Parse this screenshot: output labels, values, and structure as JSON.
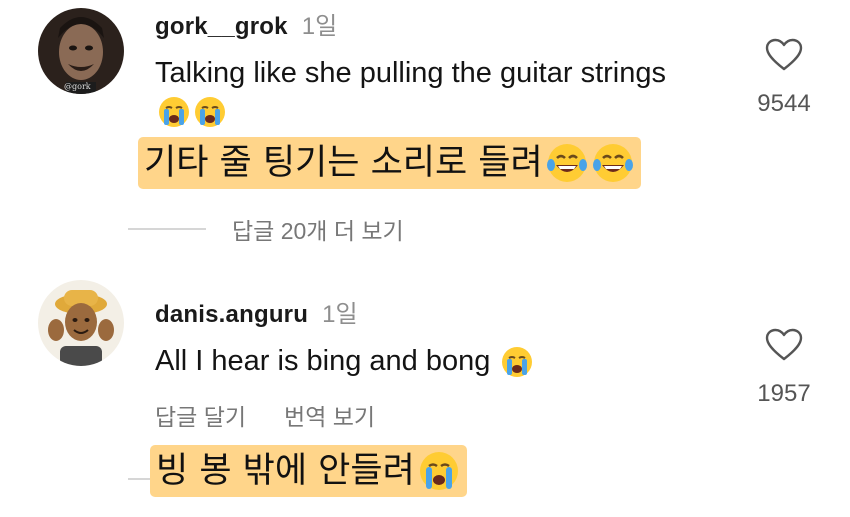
{
  "comments": [
    {
      "username": "gork__grok",
      "time": "1일",
      "text": "Talking like she pulling the guitar strings",
      "emoji": "crying-face-icon x2",
      "translation": "기타 줄 팅기는 소리로 들려",
      "translation_emoji": "laughing-tears-icon x2",
      "likes": "9544",
      "view_replies": "답글 20개 더 보기",
      "avatar_caption": "@gork"
    },
    {
      "username": "danis.anguru",
      "time": "1일",
      "text": "All I hear is bing and bong",
      "emoji": "crying-face-icon",
      "translation": "빙 봉 밖에 안들려",
      "translation_emoji": "crying-face-icon",
      "likes": "1957",
      "actions": [
        "답글 달기",
        "번역 보기"
      ]
    }
  ],
  "colors": {
    "highlight": "#ffd58a",
    "muted_text": "#8e8e8e",
    "emoji_yellow": "#ffcc33",
    "tear_blue": "#4aa3e8"
  }
}
